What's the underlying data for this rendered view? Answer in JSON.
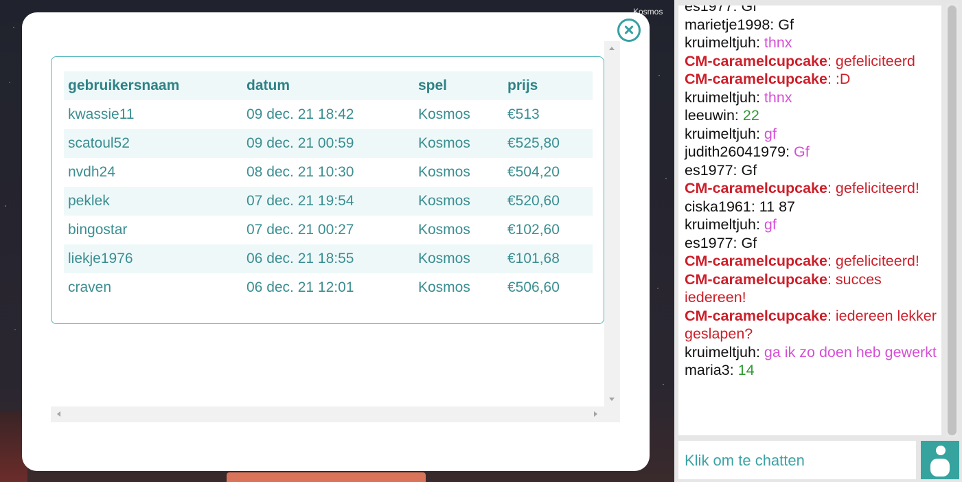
{
  "background": {
    "game_title": "Kosmos"
  },
  "winners_table": {
    "headers": [
      "gebruikersnaam",
      "datum",
      "spel",
      "prijs"
    ],
    "rows": [
      [
        "kwassie11",
        "09 dec. 21 18:42",
        "Kosmos",
        "€513"
      ],
      [
        "scatoul52",
        "09 dec. 21 00:59",
        "Kosmos",
        "€525,80"
      ],
      [
        "nvdh24",
        "08 dec. 21 10:30",
        "Kosmos",
        "€504,20"
      ],
      [
        "peklek",
        "07 dec. 21 19:54",
        "Kosmos",
        "€520,60"
      ],
      [
        "bingostar",
        "07 dec. 21 00:27",
        "Kosmos",
        "€102,60"
      ],
      [
        "liekje1976",
        "06 dec. 21 18:55",
        "Kosmos",
        "€101,68"
      ],
      [
        "craven",
        "06 dec. 21 12:01",
        "Kosmos",
        "€506,60"
      ]
    ]
  },
  "chat": {
    "messages": [
      {
        "user": "es1977",
        "text": "Gf",
        "style": "plain"
      },
      {
        "user": "marietje1998",
        "text": "Gf",
        "style": "plain"
      },
      {
        "user": "kruimeltjuh",
        "text": "thnx",
        "style": "pink"
      },
      {
        "user": "CM-caramelcupcake",
        "text": "gefeliciteerd",
        "style": "mod"
      },
      {
        "user": "CM-caramelcupcake",
        "text": ":D",
        "style": "mod"
      },
      {
        "user": "kruimeltjuh",
        "text": "thnx",
        "style": "pink"
      },
      {
        "user": "leeuwin",
        "text": "22",
        "style": "green"
      },
      {
        "user": "kruimeltjuh",
        "text": "gf",
        "style": "pink"
      },
      {
        "user": "judith26041979",
        "text": "Gf",
        "style": "pink"
      },
      {
        "user": "es1977",
        "text": "Gf",
        "style": "plain"
      },
      {
        "user": "CM-caramelcupcake",
        "text": "gefeliciteerd!",
        "style": "mod"
      },
      {
        "user": "ciska1961",
        "text": "11 87",
        "style": "plain"
      },
      {
        "user": "kruimeltjuh",
        "text": "gf",
        "style": "pink"
      },
      {
        "user": "es1977",
        "text": "Gf",
        "style": "plain"
      },
      {
        "user": "CM-caramelcupcake",
        "text": "gefeliciteerd!",
        "style": "mod"
      },
      {
        "user": "CM-caramelcupcake",
        "text": "succes iedereen!",
        "style": "mod"
      },
      {
        "user": "CM-caramelcupcake",
        "text": "iedereen lekker geslapen?",
        "style": "mod"
      },
      {
        "user": "kruimeltjuh",
        "text": "ga ik zo doen heb gewerkt",
        "style": "pink"
      },
      {
        "user": "maria3",
        "text": "14",
        "style": "green"
      }
    ],
    "input_placeholder": "Klik om te chatten"
  },
  "colors": {
    "accent": "#36a0a3",
    "moderator": "#cc1f2a",
    "pink": "#d64fd6",
    "green": "#2f9a31"
  },
  "icons": {
    "close": "close-circle-icon",
    "user": "user-icon"
  }
}
